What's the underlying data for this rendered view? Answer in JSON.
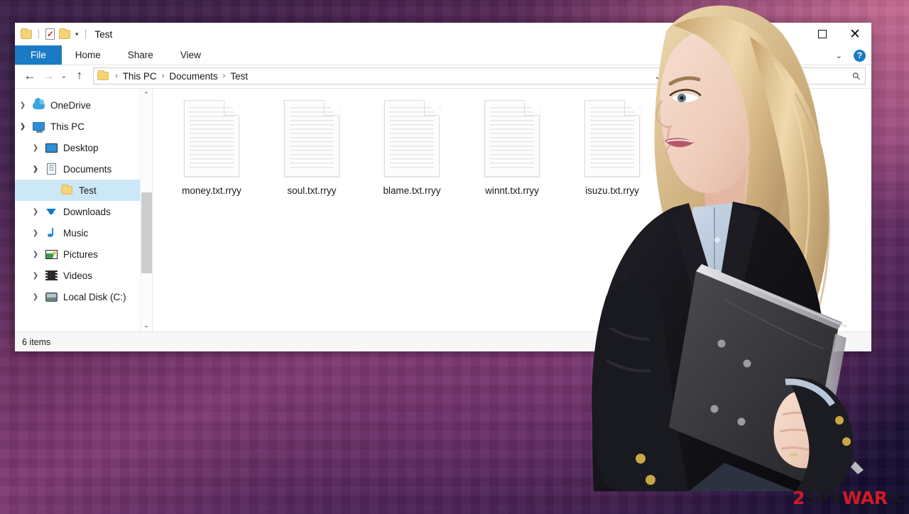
{
  "window": {
    "title": "Test",
    "quick_access": [
      {
        "name": "folder-icon",
        "label": ""
      },
      {
        "name": "properties-icon",
        "label": ""
      },
      {
        "name": "new-folder-icon",
        "label": ""
      },
      {
        "name": "customize-quick-access-caret",
        "label": "▾"
      }
    ],
    "controls": {
      "maximize": "maximize-icon",
      "close": "✕",
      "ribbon_collapse": "⌄",
      "help": "?"
    }
  },
  "ribbon": {
    "tabs": [
      {
        "label": "File",
        "active": true
      },
      {
        "label": "Home",
        "active": false
      },
      {
        "label": "Share",
        "active": false
      },
      {
        "label": "View",
        "active": false
      }
    ]
  },
  "navigation": {
    "back": "←",
    "forward": "→",
    "recent": "⌄",
    "up": "↑",
    "breadcrumb": [
      "This PC",
      "Documents",
      "Test"
    ],
    "breadcrumb_separator": "›",
    "address_dropdown": "⌄",
    "refresh": "↻",
    "search_placeholder": "",
    "search_value": "",
    "search_icon": "search-icon"
  },
  "sidebar": {
    "items": [
      {
        "label": "OneDrive",
        "icon": "cloud-icon",
        "indent": 0,
        "chevron": "closed",
        "selected": false
      },
      {
        "label": "This PC",
        "icon": "pc-icon",
        "indent": 0,
        "chevron": "open",
        "selected": false
      },
      {
        "label": "Desktop",
        "icon": "desktop-icon",
        "indent": 1,
        "chevron": "closed",
        "selected": false
      },
      {
        "label": "Documents",
        "icon": "documents-icon",
        "indent": 1,
        "chevron": "open",
        "selected": false
      },
      {
        "label": "Test",
        "icon": "folder-icon",
        "indent": 2,
        "chevron": "none",
        "selected": true
      },
      {
        "label": "Downloads",
        "icon": "downloads-icon",
        "indent": 1,
        "chevron": "closed",
        "selected": false
      },
      {
        "label": "Music",
        "icon": "music-icon",
        "indent": 1,
        "chevron": "closed",
        "selected": false
      },
      {
        "label": "Pictures",
        "icon": "pictures-icon",
        "indent": 1,
        "chevron": "closed",
        "selected": false
      },
      {
        "label": "Videos",
        "icon": "videos-icon",
        "indent": 1,
        "chevron": "closed",
        "selected": false
      },
      {
        "label": "Local Disk (C:)",
        "icon": "disk-icon",
        "indent": 1,
        "chevron": "closed",
        "selected": false
      }
    ],
    "scroll_up": "⌃",
    "scroll_down": "⌄"
  },
  "files": [
    {
      "name": "money.txt.rryy",
      "icon": "text-file-icon"
    },
    {
      "name": "soul.txt.rryy",
      "icon": "text-file-icon"
    },
    {
      "name": "blame.txt.rryy",
      "icon": "text-file-icon"
    },
    {
      "name": "winnt.txt.rryy",
      "icon": "text-file-icon"
    },
    {
      "name": "isuzu.txt.rryy",
      "icon": "text-file-icon"
    }
  ],
  "status": {
    "item_count": "6 items"
  },
  "watermark": {
    "part1": "2",
    "part2": "SPY",
    "part3": "WAR",
    "chevron": "≪"
  },
  "colors": {
    "accent_blue": "#1a7bc4",
    "selection_blue": "#cce8f7",
    "watermark_red": "#cf1b26",
    "bg_purple": "#4a2350",
    "bg_pink": "#ce7096",
    "bg_navy": "#100a2a"
  }
}
